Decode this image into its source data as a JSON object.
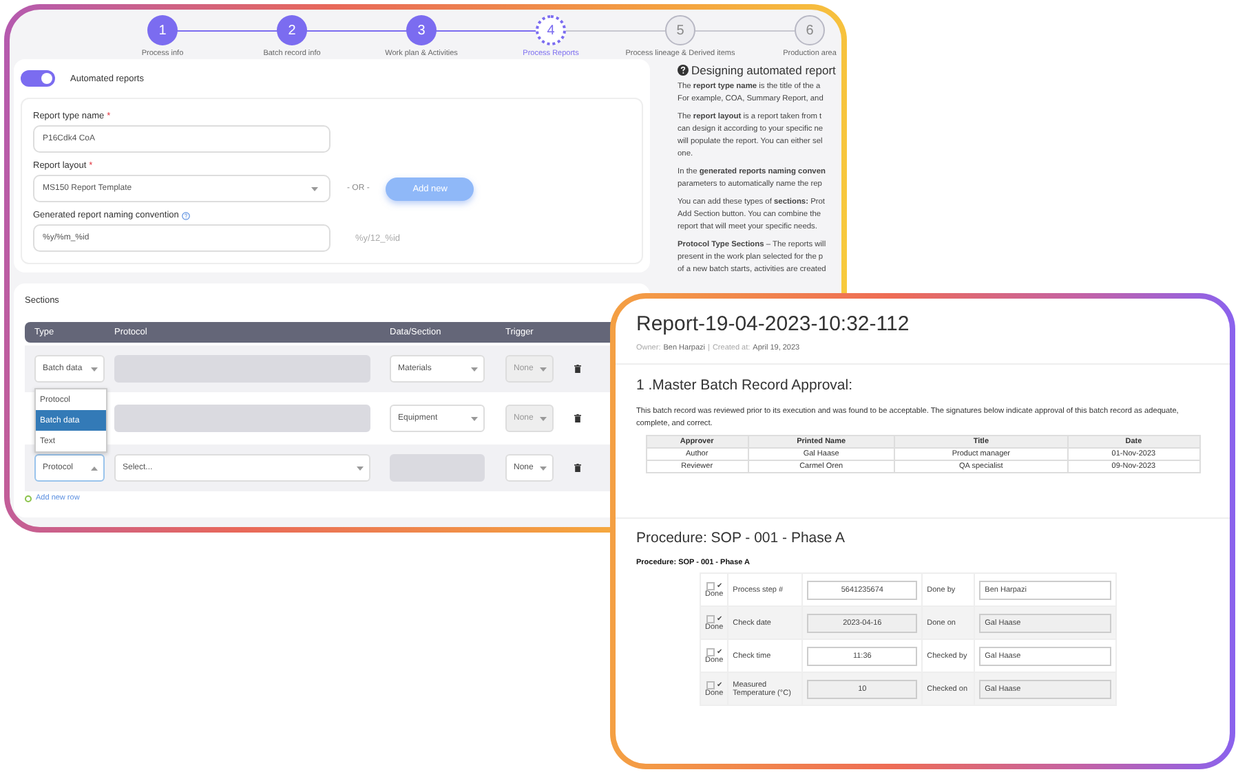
{
  "process_window": {
    "steps": [
      {
        "number": "1",
        "label": "Process info",
        "completed": true,
        "selected": false
      },
      {
        "number": "2",
        "label": "Batch record info",
        "completed": true,
        "selected": false
      },
      {
        "number": "3",
        "label": "Work plan & Activities",
        "completed": true,
        "selected": false
      },
      {
        "number": "4",
        "label": "Process Reports",
        "completed": false,
        "selected": true
      },
      {
        "number": "5",
        "label": "Process lineage & Derived items",
        "completed": false,
        "selected": false
      },
      {
        "number": "6",
        "label": "Production area",
        "completed": false,
        "selected": false
      }
    ],
    "automated_reports": {
      "label": "Automated reports",
      "on": true
    },
    "report_type_name": {
      "label": "Report type name",
      "required_mark": "*",
      "value": "P16Cdk4 CoA"
    },
    "report_layout": {
      "label": "Report layout",
      "required_mark": "*",
      "value": "MS150 Report Template",
      "separator": "- OR -",
      "button": "Add new"
    },
    "naming_convention": {
      "label": "Generated report naming convention",
      "value": "%y/%m_%id",
      "preview": "%y/12_%id"
    },
    "sections": {
      "title": "Sections",
      "columns": [
        "Type",
        "Protocol",
        "Data/Section",
        "Trigger"
      ],
      "rows": [
        {
          "type": "Batch data",
          "expanded": false,
          "protocol": {
            "disabled": true
          },
          "data": {
            "value": "Materials",
            "disabled": false
          },
          "trigger": {
            "value": "None",
            "disabled": true
          }
        },
        {
          "protocol": {
            "disabled": true
          },
          "data": {
            "value": "Equipment",
            "disabled": false
          },
          "trigger": {
            "value": "None",
            "disabled": true
          }
        },
        {
          "type": "Protocol",
          "expanded": true,
          "options": [
            {
              "label": "Protocol",
              "selected": false
            },
            {
              "label": "Batch data",
              "selected": true
            },
            {
              "label": "Text",
              "selected": false
            }
          ],
          "protocol": {
            "disabled": false,
            "placeholder": "Select..."
          },
          "data": {
            "disabled": true
          },
          "trigger": {
            "value": "None",
            "disabled": false
          }
        }
      ],
      "add_row": "Add new row"
    },
    "help": {
      "title": "Designing automated report",
      "paragraphs": [
        [
          "The **report type name** is the title of the a",
          "For example, COA, Summary Report, and"
        ],
        [
          "The **report layout** is a report taken from t",
          "can design it according to your specific ne",
          "will populate the report. You can either sel",
          "one."
        ],
        [
          "In the **generated reports naming conven**",
          "parameters to automatically name the rep"
        ],
        [
          "You can add these types of **sections:** Prot",
          "Add Section button. You can combine the",
          "report that will meet your specific needs."
        ],
        [
          "**Protocol Type Sections** – The reports will",
          "present in the work plan selected for the p",
          "of a new batch starts, activities are created"
        ]
      ]
    }
  },
  "report_window": {
    "title": "Report-19-04-2023-10:32-112",
    "meta": {
      "owner_label": "Owner:",
      "owner": "Ben Harpazi",
      "separator": "|",
      "created_label": "Created at:",
      "created": "April 19, 2023"
    },
    "approval": {
      "heading": "1 .Master Batch Record Approval:",
      "text": "This batch record was reviewed prior to its execution and was found to be acceptable. The signatures below indicate approval of this batch record as adequate, complete, and correct.",
      "columns": [
        "Approver",
        "Printed Name",
        "Title",
        "Date"
      ],
      "rows": [
        [
          "Author",
          "Gal Haase",
          "Product manager",
          "01-Nov-2023"
        ],
        [
          "Reviewer",
          "Carmel Oren",
          "QA specialist",
          "09-Nov-2023"
        ]
      ]
    },
    "procedure": {
      "heading": "Procedure: SOP - 001 - Phase A",
      "subheading": "Procedure: SOP - 001 - Phase A",
      "rows": [
        {
          "checked": false,
          "mark": "✔",
          "done_label": "Done",
          "step": "Process step #",
          "value": "5641235674",
          "role": "Done by",
          "person": "Ben Harpazi"
        },
        {
          "checked": false,
          "mark": "✔",
          "done_label": "Done",
          "step": "Check date",
          "value": "2023-04-16",
          "role": "Done on",
          "person": "Gal Haase"
        },
        {
          "checked": false,
          "mark": "✔",
          "done_label": "Done",
          "step": "Check time",
          "value": "11:36",
          "role": "Checked by",
          "person": "Gal Haase"
        },
        {
          "checked": false,
          "mark": "✔",
          "done_label": "Done",
          "step": "Measured Temperature (°C)",
          "value": "10",
          "role": "Checked on",
          "person": "Gal Haase"
        }
      ]
    }
  }
}
